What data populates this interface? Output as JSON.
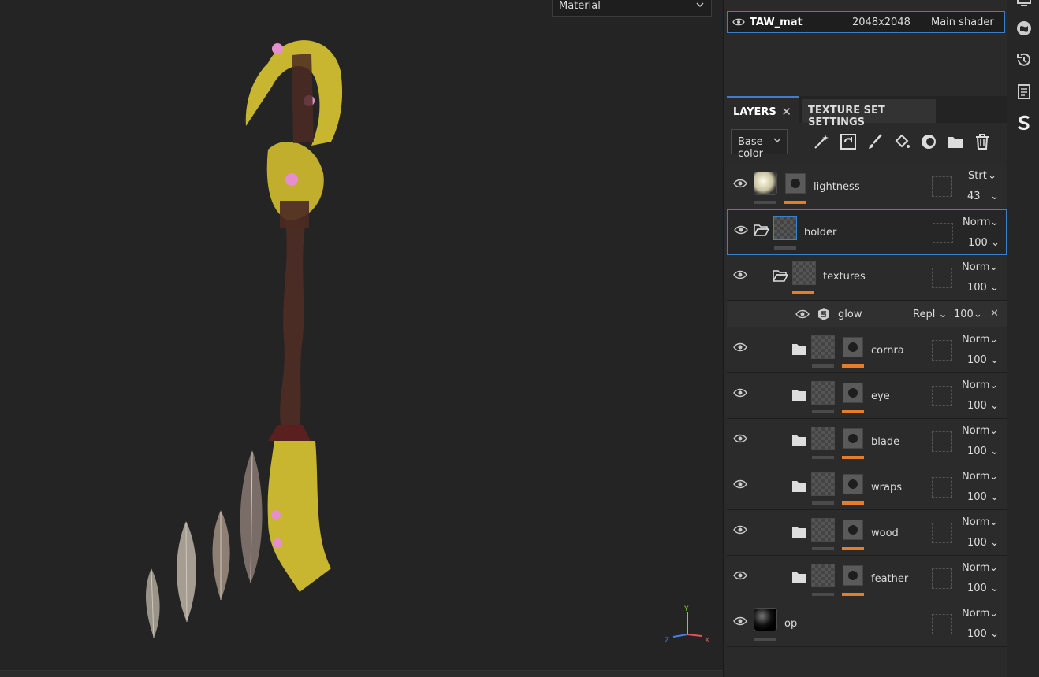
{
  "viewport": {
    "material_select": "Material"
  },
  "axis": {
    "x": "X",
    "y": "Y",
    "z": "Z"
  },
  "texture_set": {
    "name": "TAW_mat",
    "resolution": "2048x2048",
    "shader": "Main shader"
  },
  "tabs": {
    "layers": "LAYERS",
    "texture_set_settings": "TEXTURE SET SETTINGS"
  },
  "toolbar": {
    "channel": "Base color"
  },
  "layers": [
    {
      "name": "lightness",
      "blend": "Strt",
      "opacity": "43"
    },
    {
      "name": "holder",
      "blend": "Norm",
      "opacity": "100"
    },
    {
      "name": "textures",
      "blend": "Norm",
      "opacity": "100"
    },
    {
      "name": "glow",
      "blend": "Repl",
      "opacity": "100"
    },
    {
      "name": "cornra",
      "blend": "Norm",
      "opacity": "100"
    },
    {
      "name": "eye",
      "blend": "Norm",
      "opacity": "100"
    },
    {
      "name": "blade",
      "blend": "Norm",
      "opacity": "100"
    },
    {
      "name": "wraps",
      "blend": "Norm",
      "opacity": "100"
    },
    {
      "name": "wood",
      "blend": "Norm",
      "opacity": "100"
    },
    {
      "name": "feather",
      "blend": "Norm",
      "opacity": "100"
    },
    {
      "name": "op",
      "blend": "Norm",
      "opacity": "100"
    }
  ],
  "colors": {
    "accent": "#3d7fcf",
    "mask_bar": "#e77d26"
  }
}
